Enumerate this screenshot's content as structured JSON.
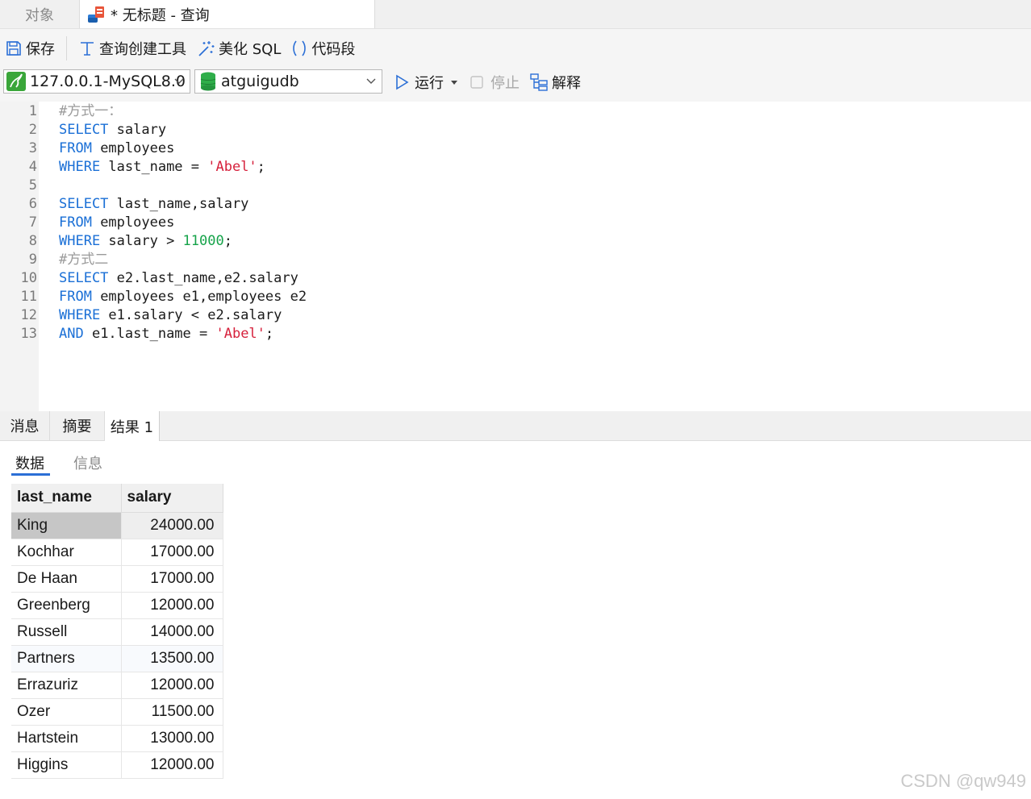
{
  "tabs": {
    "objects_label": "对象",
    "query_label": "* 无标题 - 查询"
  },
  "toolbar": {
    "save_label": "保存",
    "query_builder_label": "查询创建工具",
    "beautify_label": "美化 SQL",
    "snippet_label": "代码段",
    "connection_value": "127.0.0.1-MySQL8.0",
    "database_value": "atguigudb",
    "run_label": "运行",
    "stop_label": "停止",
    "explain_label": "解释"
  },
  "editor": {
    "line_numbers": [
      "1",
      "2",
      "3",
      "4",
      "5",
      "6",
      "7",
      "8",
      "9",
      "10",
      "11",
      "12",
      "13"
    ],
    "lines": [
      {
        "parts": [
          {
            "t": "#方式一：",
            "c": "cmt"
          }
        ]
      },
      {
        "parts": [
          {
            "t": "SELECT",
            "c": "kw"
          },
          {
            "t": " salary",
            "c": ""
          }
        ]
      },
      {
        "parts": [
          {
            "t": "FROM",
            "c": "kw"
          },
          {
            "t": " employees",
            "c": ""
          }
        ]
      },
      {
        "parts": [
          {
            "t": "WHERE",
            "c": "kw"
          },
          {
            "t": " last_name = ",
            "c": ""
          },
          {
            "t": "'Abel'",
            "c": "str"
          },
          {
            "t": ";",
            "c": ""
          }
        ]
      },
      {
        "parts": []
      },
      {
        "parts": [
          {
            "t": "SELECT",
            "c": "kw"
          },
          {
            "t": " last_name,salary",
            "c": ""
          }
        ]
      },
      {
        "parts": [
          {
            "t": "FROM",
            "c": "kw"
          },
          {
            "t": " employees",
            "c": ""
          }
        ]
      },
      {
        "parts": [
          {
            "t": "WHERE",
            "c": "kw"
          },
          {
            "t": " salary > ",
            "c": ""
          },
          {
            "t": "11000",
            "c": "num"
          },
          {
            "t": ";",
            "c": ""
          }
        ]
      },
      {
        "parts": [
          {
            "t": "#方式二",
            "c": "cmt"
          }
        ]
      },
      {
        "parts": [
          {
            "t": "SELECT",
            "c": "kw"
          },
          {
            "t": " e2.last_name,e2.salary",
            "c": ""
          }
        ]
      },
      {
        "parts": [
          {
            "t": "FROM",
            "c": "kw"
          },
          {
            "t": " employees e1,employees e2",
            "c": ""
          }
        ]
      },
      {
        "parts": [
          {
            "t": "WHERE",
            "c": "kw"
          },
          {
            "t": " e1.salary < e2.salary",
            "c": ""
          }
        ]
      },
      {
        "parts": [
          {
            "t": "AND",
            "c": "kw"
          },
          {
            "t": " e1.last_name = ",
            "c": ""
          },
          {
            "t": "'Abel'",
            "c": "str"
          },
          {
            "t": ";",
            "c": ""
          }
        ]
      }
    ]
  },
  "result_tabs": {
    "messages": "消息",
    "summary": "摘要",
    "result1": "结果 1"
  },
  "sub_tabs": {
    "data": "数据",
    "info": "信息"
  },
  "table": {
    "columns": [
      "last_name",
      "salary"
    ],
    "rows": [
      [
        "King",
        "24000.00"
      ],
      [
        "Kochhar",
        "17000.00"
      ],
      [
        "De Haan",
        "17000.00"
      ],
      [
        "Greenberg",
        "12000.00"
      ],
      [
        "Russell",
        "14000.00"
      ],
      [
        "Partners",
        "13500.00"
      ],
      [
        "Errazuriz",
        "12000.00"
      ],
      [
        "Ozer",
        "11500.00"
      ],
      [
        "Hartstein",
        "13000.00"
      ],
      [
        "Higgins",
        "12000.00"
      ]
    ]
  },
  "watermark": "CSDN @qw949",
  "colors": {
    "keyword": "#1a6fd6",
    "string": "#d6213c",
    "number": "#16a34a",
    "comment": "#9a9a9a",
    "accent": "#2b6fd6"
  }
}
